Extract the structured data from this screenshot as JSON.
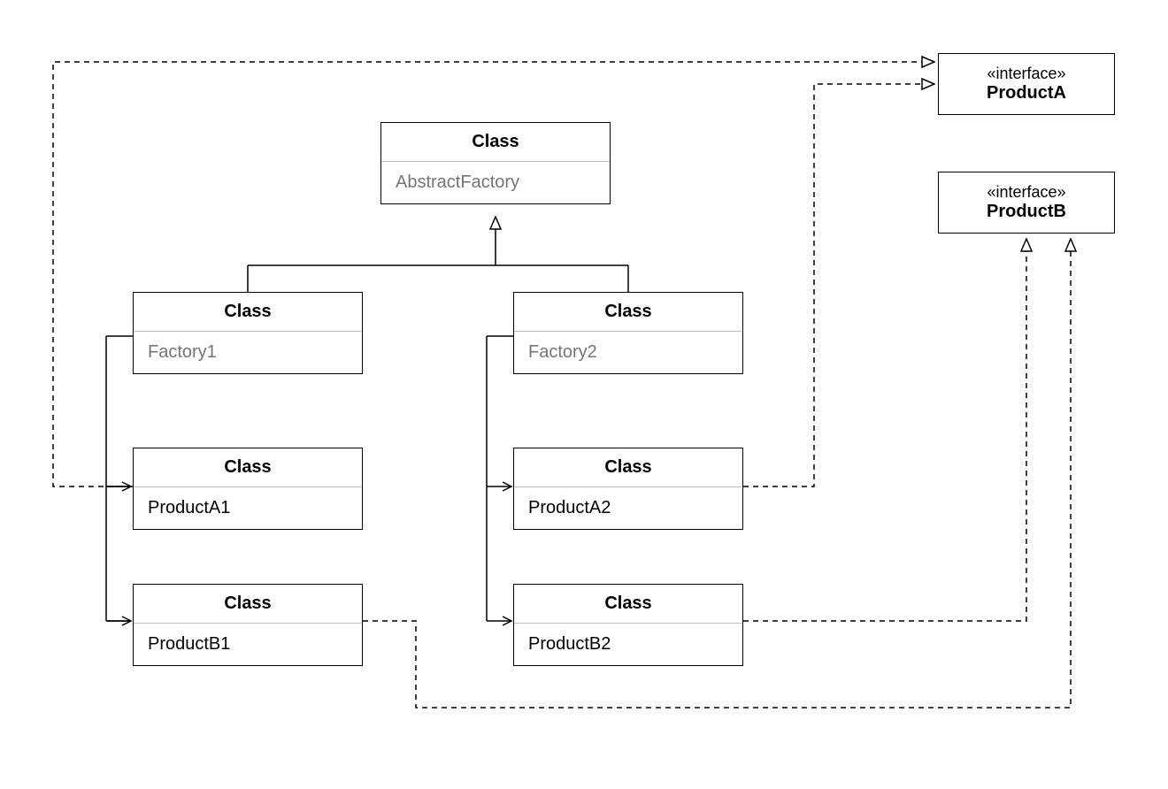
{
  "nodes": {
    "abstractFactory": {
      "header": "Class",
      "body": "AbstractFactory"
    },
    "factory1": {
      "header": "Class",
      "body": "Factory1"
    },
    "factory2": {
      "header": "Class",
      "body": "Factory2"
    },
    "productA1": {
      "header": "Class",
      "body": "ProductA1"
    },
    "productA2": {
      "header": "Class",
      "body": "ProductA2"
    },
    "productB1": {
      "header": "Class",
      "body": "ProductB1"
    },
    "productB2": {
      "header": "Class",
      "body": "ProductB2"
    },
    "iProductA": {
      "stereotype": "«interface»",
      "name": "ProductA"
    },
    "iProductB": {
      "stereotype": "«interface»",
      "name": "ProductB"
    }
  }
}
